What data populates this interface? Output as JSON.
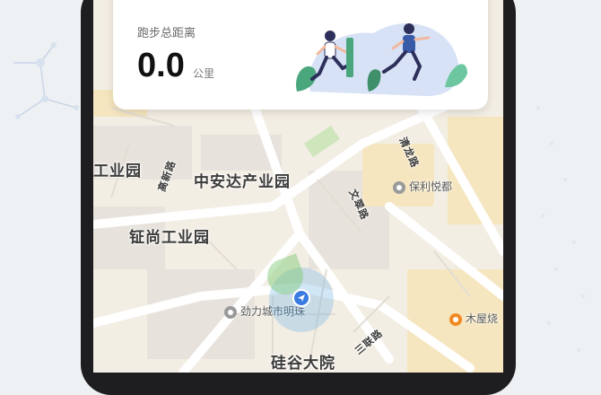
{
  "summary_card": {
    "title": "跑步总距离",
    "distance_value": "0.0",
    "distance_unit": "公里"
  },
  "map": {
    "labels": {
      "area_1": "工业园",
      "area_2": "中安达产业园",
      "area_3": "钲尚工业园",
      "area_4": "硅谷大院",
      "poi_1": "劲力城市明珠",
      "poi_2": "保利悦都",
      "poi_3": "木屋烧",
      "road_1": "清龙路",
      "road_2": "三联路",
      "road_3": "文翠路",
      "road_4": "高新路"
    }
  },
  "colors": {
    "accent": "#3a7be0",
    "card_bg": "#ffffff",
    "map_land": "#f3eee4",
    "frame": "#1e1e20"
  }
}
